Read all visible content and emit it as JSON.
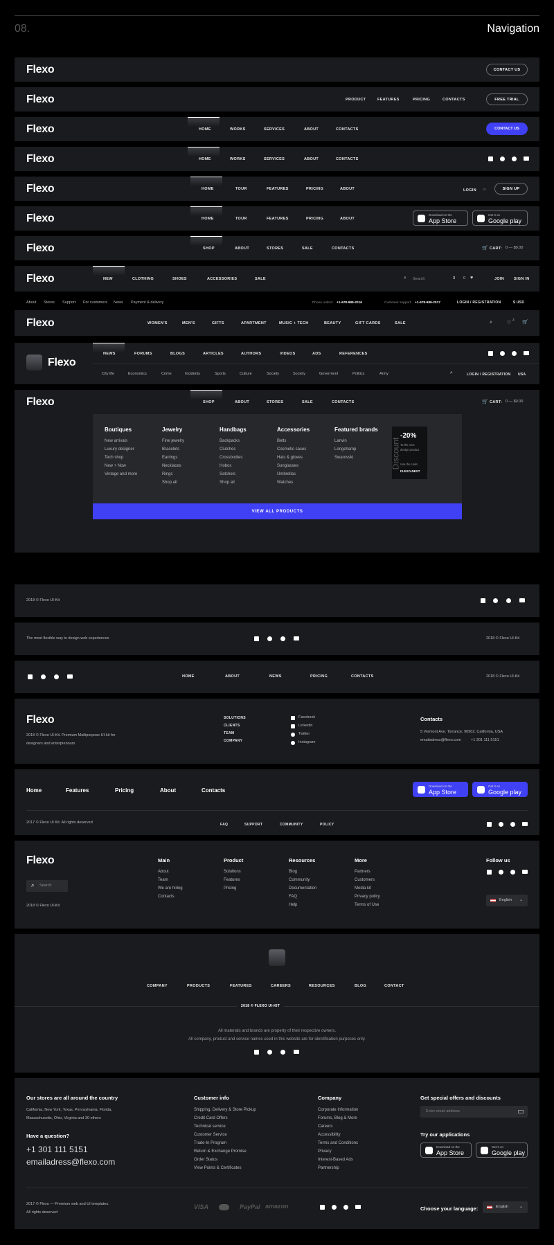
{
  "header": {
    "number": "08.",
    "title": "Navigation"
  },
  "brand": {
    "logo": "Flexo",
    "accent": "#4040f5",
    "bar_bg": "#1a1b1e"
  },
  "nav1": {
    "button": "CONTACT US"
  },
  "nav2": {
    "links": [
      "PRODUCT",
      "FEATURES",
      "PRICING",
      "CONTACTS"
    ],
    "button": "FREE TRIAL"
  },
  "nav3": {
    "links": [
      "HOME",
      "WORKS",
      "SERVICES",
      "ABOUT",
      "CONTACTS"
    ],
    "button": "CONTACT US"
  },
  "nav4": {
    "links": [
      "HOME",
      "WORKS",
      "SERVICES",
      "ABOUT",
      "CONTACTS"
    ],
    "social": [
      "facebook-icon",
      "instagram-icon",
      "twitter-icon",
      "youtube-icon"
    ]
  },
  "nav5": {
    "links": [
      "HOME",
      "TOUR",
      "FEATURES",
      "PRICING",
      "ABOUT"
    ],
    "login": "LOGIN",
    "or": "or",
    "signup": "SIGN UP"
  },
  "nav6": {
    "links": [
      "HOME",
      "TOUR",
      "FEATURES",
      "PRICING",
      "ABOUT"
    ],
    "appstore_small": "Download on the",
    "appstore_big": "App Store",
    "gplay_small": "Get it on",
    "gplay_big": "Google play"
  },
  "nav7": {
    "links": [
      "SHOP",
      "ABOUT",
      "STORES",
      "SALE",
      "CONTACTS"
    ],
    "cart_label": "CART:",
    "cart_value": "0 — $0.00"
  },
  "nav8": {
    "links": [
      "NEW",
      "CLOTHING",
      "SHOES",
      "ACCESSORIES",
      "SALE"
    ],
    "search_placeholder": "Search",
    "count1": "3",
    "count2": "0",
    "join": "JOIN",
    "signin": "SIGN IN"
  },
  "nav9": {
    "top_links": [
      "About",
      "Stores",
      "Support",
      "For customers",
      "News",
      "Payment & delivery"
    ],
    "phone_label": "Phone orders:",
    "phone": "+1-678-989-2016",
    "support_label": "Customer support:",
    "support": "+1-678-989-2017",
    "auth": "LOGIN / REGISTRATION",
    "region": "$ USD",
    "links": [
      "WOMEN'S",
      "MEN'S",
      "GIFTS",
      "APARTMENT",
      "MUSIC + TECH",
      "BEAUTY",
      "GIFT CARDS",
      "SALE"
    ],
    "heart_count": "3"
  },
  "nav10": {
    "links": [
      "NEWS",
      "FORUMS",
      "BLOGS",
      "ARTICLES",
      "AUTHORS",
      "VIDEOS",
      "ADS",
      "REFERENCES"
    ],
    "sub_links": [
      "City life",
      "Economics",
      "Crime",
      "Incidents",
      "Sports",
      "Culture",
      "Society",
      "Society",
      "Goverment",
      "Politics",
      "Army"
    ],
    "auth": "LOGIN / REGISTRATION",
    "region": "USA"
  },
  "nav11": {
    "links": [
      "SHOP",
      "ABOUT",
      "STORES",
      "SALE",
      "CONTACTS"
    ],
    "cart_label": "CART:",
    "cart_value": "0 — $0.00",
    "columns": [
      {
        "head": "Boutiques",
        "items": [
          "New arrivals",
          "Luxury designer",
          "Tech shop",
          "New + Now",
          "Vintage and more"
        ]
      },
      {
        "head": "Jewelry",
        "items": [
          "Fine jewelry",
          "Bracelets",
          "Earrings",
          "Necklaces",
          "Rings",
          "Shop all"
        ]
      },
      {
        "head": "Handbags",
        "items": [
          "Backpacks",
          "Clutches",
          "Crossbodies",
          "Hobos",
          "Satchels",
          "Shop all"
        ]
      },
      {
        "head": "Accessories",
        "items": [
          "Belts",
          "Cosmetic cases",
          "Hats & gloves",
          "Sunglasses",
          "Umbrellas",
          "Watches"
        ]
      },
      {
        "head": "Featured brands",
        "items": [
          "Lanvin",
          "Longchamp",
          "Swarovski"
        ]
      }
    ],
    "promo": {
      "vertical": "Discount",
      "percent": "-20%",
      "line1": "To the next",
      "line2": "design product",
      "code_label": "Use the code:",
      "code": "FLEXO-NEXT",
      "watch": "09"
    },
    "cta": "VIEW ALL PRODUCTS"
  },
  "footer1": {
    "copyright": "2018 © Flexo UI-Kit"
  },
  "footer2": {
    "tagline": "The most flexible way to design web experiences",
    "copyright": "2018 © Flexo UI-Kit"
  },
  "footer3": {
    "links": [
      "HOME",
      "ABOUT",
      "NEWS",
      "PRICING",
      "CONTACTS"
    ],
    "copyright": "2018 © Flexo UI-Kit"
  },
  "footer4": {
    "desc1": "2018 © Flexo UI-Kit. Premium Multipurpose UI-kit for",
    "desc2": "designers and enterprenours",
    "links": [
      "SOLUTIONS",
      "CLIENTS",
      "TEAM",
      "COMPANY"
    ],
    "social": [
      "Facebook",
      "Linkedin",
      "Twitter",
      "Instagram"
    ],
    "contacts_head": "Contacts",
    "address": "5 Vermont Ave. Torrance, 90502. California, USA",
    "email": "emailadress@flexo.com",
    "phone": "+1 301 111 5151"
  },
  "footer5": {
    "links": [
      "Home",
      "Features",
      "Pricing",
      "About",
      "Contacts"
    ],
    "appstore_small": "Download on the",
    "appstore_big": "App Store",
    "gplay_small": "Get it on",
    "gplay_big": "Google play",
    "copyright": "2017 © Flexo UI Kit. All rights deserved",
    "bottom_links": [
      "FAQ",
      "SUPPORT",
      "COMMUNITY",
      "POLICY"
    ]
  },
  "footer6": {
    "search_placeholder": "Search",
    "copyright": "2018 © Flexo UI-Kit",
    "columns": [
      {
        "head": "Main",
        "items": [
          "About",
          "Team",
          "We are hiring",
          "Contacts"
        ]
      },
      {
        "head": "Product",
        "items": [
          "Solutions",
          "Features",
          "Pricing"
        ]
      },
      {
        "head": "Resources",
        "items": [
          "Blog",
          "Community",
          "Documentation",
          "FAQ",
          "Help"
        ]
      },
      {
        "head": "More",
        "items": [
          "Partners",
          "Customers",
          "Media kit",
          "Privacy policy",
          "Terms of Use"
        ]
      }
    ],
    "follow": "Follow us",
    "language": "English"
  },
  "footer7": {
    "links": [
      "COMPANY",
      "PRODUCTS",
      "FEATURES",
      "CAREERS",
      "RESOURCES",
      "BLOG",
      "CONTACT"
    ],
    "badge": "2018 © FLEXO UI-KIT",
    "note1": "All materials and brands are property of their respective owners.",
    "note2": "All company, product and service names used in this website are for identification purposes only."
  },
  "footer8": {
    "stores_head": "Our stores are all around the country",
    "stores_text1": "California, New York, Texas, Pennsylvania, Florida,",
    "stores_text2": "Massachusetts, Ohio, Virginia and 30 others",
    "question": "Have a question?",
    "phone": "+1 301 111 5151",
    "email": "emailadress@flexo.com",
    "ci_head": "Customer info",
    "ci_items": [
      "Shipping, Delivery & Store Pickup",
      "Credit Card Offers",
      "Technical service",
      "Customer Service",
      "Trade-In Program",
      "Return & Exchange Promise",
      "Order Status",
      "View Points & Certificates"
    ],
    "co_head": "Company",
    "co_items": [
      "Corporate Information",
      "Forums, Blog & More",
      "Careers",
      "Accessibility",
      "Terms and Conditions",
      "Privacy",
      "Interest-Based Ads",
      "Partnership"
    ],
    "offers_head": "Get special offers and discounts",
    "email_placeholder": "Enter email address",
    "apps_head": "Try our applications",
    "appstore_small": "Download on the",
    "appstore_big": "App Store",
    "gplay_small": "Get it on",
    "gplay_big": "Google play",
    "copyright1": "2017 © Flexo — Premium web and UI templates.",
    "copyright2": "All rights deserved",
    "payments": [
      "VISA",
      "PayPal",
      "amazon"
    ],
    "language_label": "Choose your language:",
    "language": "English"
  }
}
